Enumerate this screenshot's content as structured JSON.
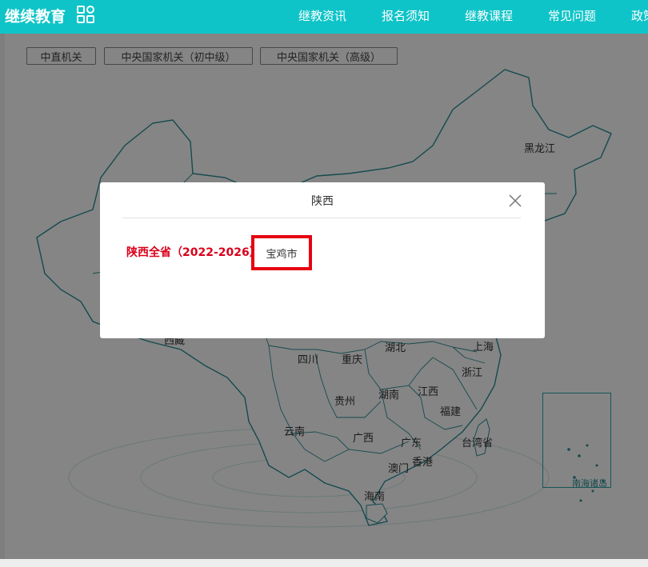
{
  "header": {
    "logo": "继续教育",
    "nav": [
      "继教资讯",
      "报名须知",
      "继教课程",
      "常见问题",
      "政策"
    ]
  },
  "categories": [
    "中直机关",
    "中央国家机关（初中级）",
    "中央国家机关（高级）"
  ],
  "map": {
    "provinces": [
      "黑龙江",
      "西藏",
      "四川",
      "重庆",
      "湖北",
      "上海",
      "浙江",
      "贵州",
      "湖南",
      "江西",
      "福建",
      "云南",
      "广西",
      "广东",
      "台湾省",
      "香港",
      "澳门",
      "海南"
    ],
    "inset_label": "南海诸岛"
  },
  "modal": {
    "title": "陕西",
    "province_all": "陕西全省（2022-2026）",
    "cities": [
      "宝鸡市"
    ]
  },
  "colors": {
    "header_bg": "#0ec4c8",
    "highlight": "#e60012",
    "province_text": "#d9001b",
    "map_stroke": "#2a8f96"
  }
}
